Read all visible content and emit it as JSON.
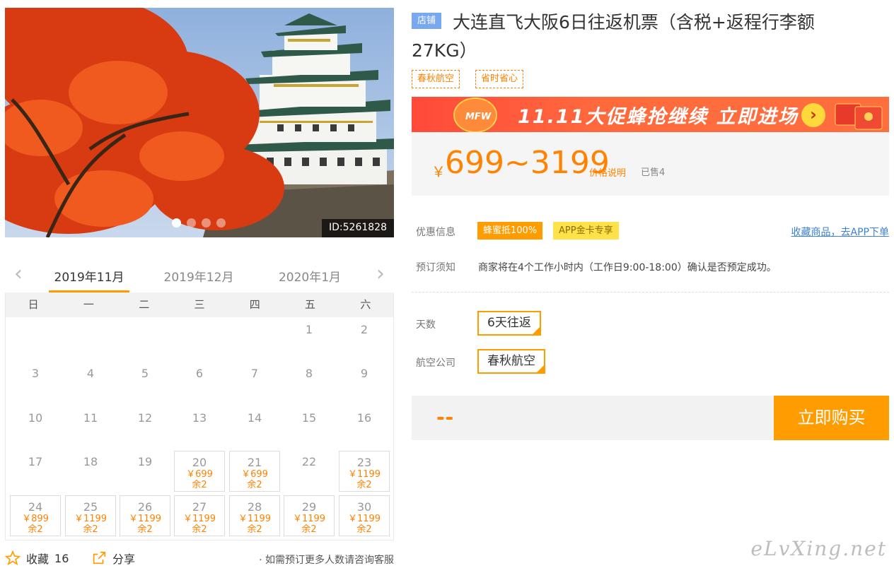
{
  "hero": {
    "id_text": "ID:5261828"
  },
  "calendar": {
    "months": [
      "2019年11月",
      "2019年12月",
      "2020年1月"
    ],
    "weekdays": [
      "日",
      "一",
      "二",
      "三",
      "四",
      "五",
      "六"
    ],
    "days": [
      {
        "d": "1"
      },
      {
        "d": "2"
      },
      {
        "d": "3"
      },
      {
        "d": "4"
      },
      {
        "d": "5"
      },
      {
        "d": "6"
      },
      {
        "d": "7"
      },
      {
        "d": "8"
      },
      {
        "d": "9"
      },
      {
        "d": "10"
      },
      {
        "d": "11"
      },
      {
        "d": "12"
      },
      {
        "d": "13"
      },
      {
        "d": "14"
      },
      {
        "d": "15"
      },
      {
        "d": "16"
      },
      {
        "d": "17"
      },
      {
        "d": "18"
      },
      {
        "d": "19"
      },
      {
        "d": "20",
        "price": "￥699",
        "left": "余2"
      },
      {
        "d": "21",
        "price": "￥699",
        "left": "余2"
      },
      {
        "d": "22"
      },
      {
        "d": "23",
        "price": "￥1199",
        "left": "余2"
      },
      {
        "d": "24",
        "price": "￥899",
        "left": "余2"
      },
      {
        "d": "25",
        "price": "￥1199",
        "left": "余2"
      },
      {
        "d": "26",
        "price": "￥1199",
        "left": "余2"
      },
      {
        "d": "27",
        "price": "￥1199",
        "left": "余2"
      },
      {
        "d": "28",
        "price": "￥1199",
        "left": "余2"
      },
      {
        "d": "29",
        "price": "￥1199",
        "left": "余2"
      },
      {
        "d": "30",
        "price": "￥1199",
        "left": "余2"
      }
    ]
  },
  "bottom": {
    "fav_label": "收藏",
    "fav_count": "16",
    "share_label": "分享",
    "note": "· 如需预订更多人数请咨询客服"
  },
  "product": {
    "shop_badge": "店铺",
    "title": "大连直飞大阪6日往返机票（含税+返程行李额27KG）",
    "tags": [
      "春秋航空",
      "省时省心"
    ]
  },
  "promo": {
    "logo": "MFW",
    "text": "11.11大促蜂抢继续 立即进场",
    "go": "›"
  },
  "price": {
    "symbol": "￥",
    "range": "699~3199",
    "explain": "价格说明",
    "sold": "已售4"
  },
  "discount": {
    "label": "优惠信息",
    "tag1": "蜂蜜抵100%",
    "tag2": "APP金卡专享",
    "link": "收藏商品，去APP下单"
  },
  "booking": {
    "label": "预订须知",
    "text": "商家将在4个工作小时内（工作日9:00-18:00）确认是否预定成功。"
  },
  "options": {
    "days_label": "天数",
    "days_value": "6天往返",
    "airline_label": "航空公司",
    "airline_value": "春秋航空"
  },
  "buy": {
    "dash": "--",
    "button": "立即购买"
  },
  "watermark": "eLvXing.net",
  "colors": {
    "accent": "#ff9d00",
    "price": "#ff8200",
    "promo": "#ff5a3c",
    "badge": "#78a8f0"
  }
}
